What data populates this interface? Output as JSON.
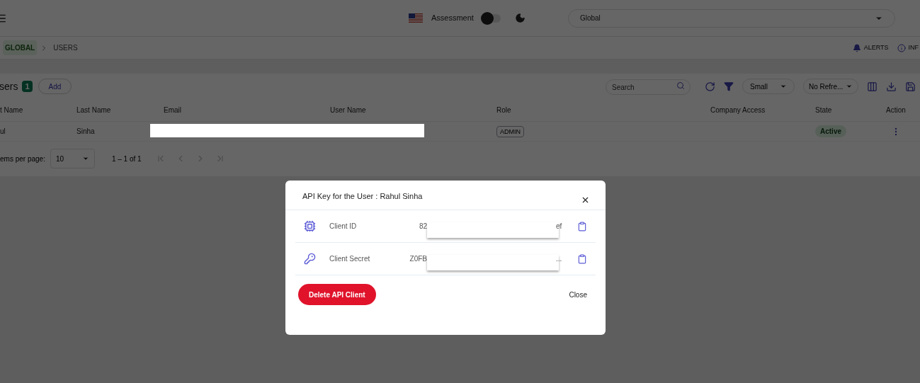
{
  "header": {
    "assessment_label": "Assessment",
    "assessment_toggle": {
      "on": false
    },
    "scope_select": {
      "value": "Global"
    }
  },
  "breadcrumb": [
    {
      "label": "GLOBAL",
      "selected": true
    },
    {
      "label": "USERS",
      "selected": false
    }
  ],
  "header_links": [
    {
      "label": "ALERTS",
      "kind": "bell"
    },
    {
      "label": "INF",
      "kind": "info"
    }
  ],
  "toolbar": {
    "title": "sers",
    "count": "1",
    "add_button": "Add",
    "search": {
      "placeholder": "Search"
    },
    "size_select": "Small",
    "refresh_select": "No Refre..."
  },
  "table": {
    "columns": [
      "t Name",
      "Last Name",
      "Email",
      "User Name",
      "Role",
      "Company Access",
      "State",
      "Action"
    ],
    "rows": [
      {
        "first_name": "ul",
        "last_name": "Sinha",
        "role": "ADMIN",
        "state": "Active"
      }
    ]
  },
  "pagination": {
    "label": "ems per page:",
    "page_size": "10",
    "range": "1 – 1 of 1"
  },
  "dialog": {
    "title": "API Key for the User : Rahul Sinha",
    "fields": [
      {
        "kind": "id",
        "label": "Client ID",
        "value_start": "82",
        "value_end": "ef"
      },
      {
        "kind": "key",
        "label": "Client Secret",
        "value_start": "Z0FB",
        "value_end": "..."
      }
    ],
    "delete_button": "Delete API Client",
    "close_button": "Close"
  }
}
